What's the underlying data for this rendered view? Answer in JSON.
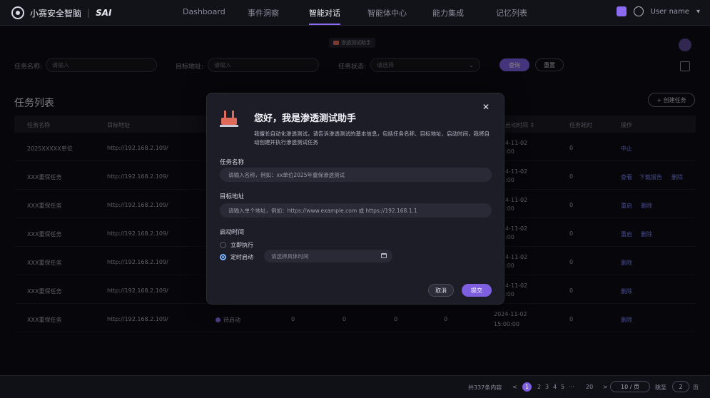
{
  "app": {
    "name": "小赛安全智脑",
    "separator": "|",
    "brand": "SAI"
  },
  "nav": {
    "items": [
      {
        "label": "Dashboard"
      },
      {
        "label": "事件洞察"
      },
      {
        "label": "智能对话"
      },
      {
        "label": "智能体中心"
      },
      {
        "label": "能力集成"
      },
      {
        "label": "记忆列表"
      }
    ],
    "active_index": 2
  },
  "user": {
    "name": "User name",
    "caret": "▾"
  },
  "agent_chip": {
    "label": "渗透测试助手"
  },
  "filters": {
    "task_name": {
      "label": "任务名称:",
      "placeholder": "请输入"
    },
    "target": {
      "label": "目标地址:",
      "placeholder": "请输入"
    },
    "status": {
      "label": "任务状态:",
      "placeholder": "请选择",
      "caret": "⌄"
    },
    "query_label": "查询",
    "reset_label": "重置"
  },
  "list": {
    "title": "任务列表",
    "create_label": "+ 创建任务",
    "columns": [
      "任务名称",
      "目标地址",
      "启动时间 ⇕",
      "任务耗时",
      "操作"
    ],
    "rows": [
      {
        "name": "2025XXXXX单位",
        "target": "http://192.168.2.109/",
        "time1": "4-11-02",
        "time2": ":00",
        "duration": "0",
        "actions": [
          "中止"
        ]
      },
      {
        "name": "XXX重保任务",
        "target": "http://192.168.2.109/",
        "time1": "4-11-02",
        "time2": ":00",
        "duration": "0",
        "actions": [
          "查看",
          "下载报告",
          "删除"
        ]
      },
      {
        "name": "XXX重保任务",
        "target": "http://192.168.2.109/",
        "time1": "4-11-02",
        "time2": ":00",
        "duration": "0",
        "actions": [
          "重启",
          "删除"
        ]
      },
      {
        "name": "XXX重保任务",
        "target": "http://192.168.2.109/",
        "time1": "4-11-02",
        "time2": ":00",
        "duration": "0",
        "actions": [
          "重启",
          "删除"
        ]
      },
      {
        "name": "XXX重保任务",
        "target": "http://192.168.2.109/",
        "time1": "4-11-02",
        "time2": ":00",
        "duration": "0",
        "actions": [
          "删除"
        ]
      },
      {
        "name": "XXX重保任务",
        "target": "http://192.168.2.109/",
        "time1": "4-11-02",
        "time2": ":00",
        "duration": "0",
        "actions": [
          "删除"
        ]
      },
      {
        "name": "XXX重保任务",
        "target": "http://192.168.2.109/",
        "status": "待启动",
        "c1": "0",
        "c2": "0",
        "c3": "0",
        "c4": "0",
        "time1": "2024-11-02",
        "time2": "15:00:00",
        "duration": "0",
        "actions": [
          "删除"
        ]
      }
    ]
  },
  "pagination": {
    "total": "共337条内容",
    "prev": "<",
    "pages": [
      "1",
      "2",
      "3",
      "4",
      "5",
      "···",
      "20"
    ],
    "next": ">",
    "page_size": "10 / 页",
    "goto_label": "跳至",
    "goto_value": "2",
    "goto_suffix": "页"
  },
  "modal": {
    "close": "✕",
    "title": "您好，我是渗透测试助手",
    "description": "我擅长自动化渗透测试，请告诉渗透测试的基本信息，包括任务名称、目标地址、启动时间，我将自动创建并执行渗透测试任务",
    "task_name_label": "任务名称",
    "task_name_placeholder": "请输入名称，例如：xx单位2025年重保渗透测试",
    "target_label": "目标地址",
    "target_placeholder": "请输入单个地址，例如：https://www.example.com 或 https://192.168.1.1",
    "start_label": "启动时间",
    "option_now": "立即执行",
    "option_scheduled": "定时启动",
    "date_placeholder": "请选择具体时间",
    "cancel_label": "取消",
    "submit_label": "提交"
  },
  "colors": {
    "accent": "#7d5fe0",
    "link": "#7f86ff",
    "danger_icon": "#e06a5a"
  }
}
